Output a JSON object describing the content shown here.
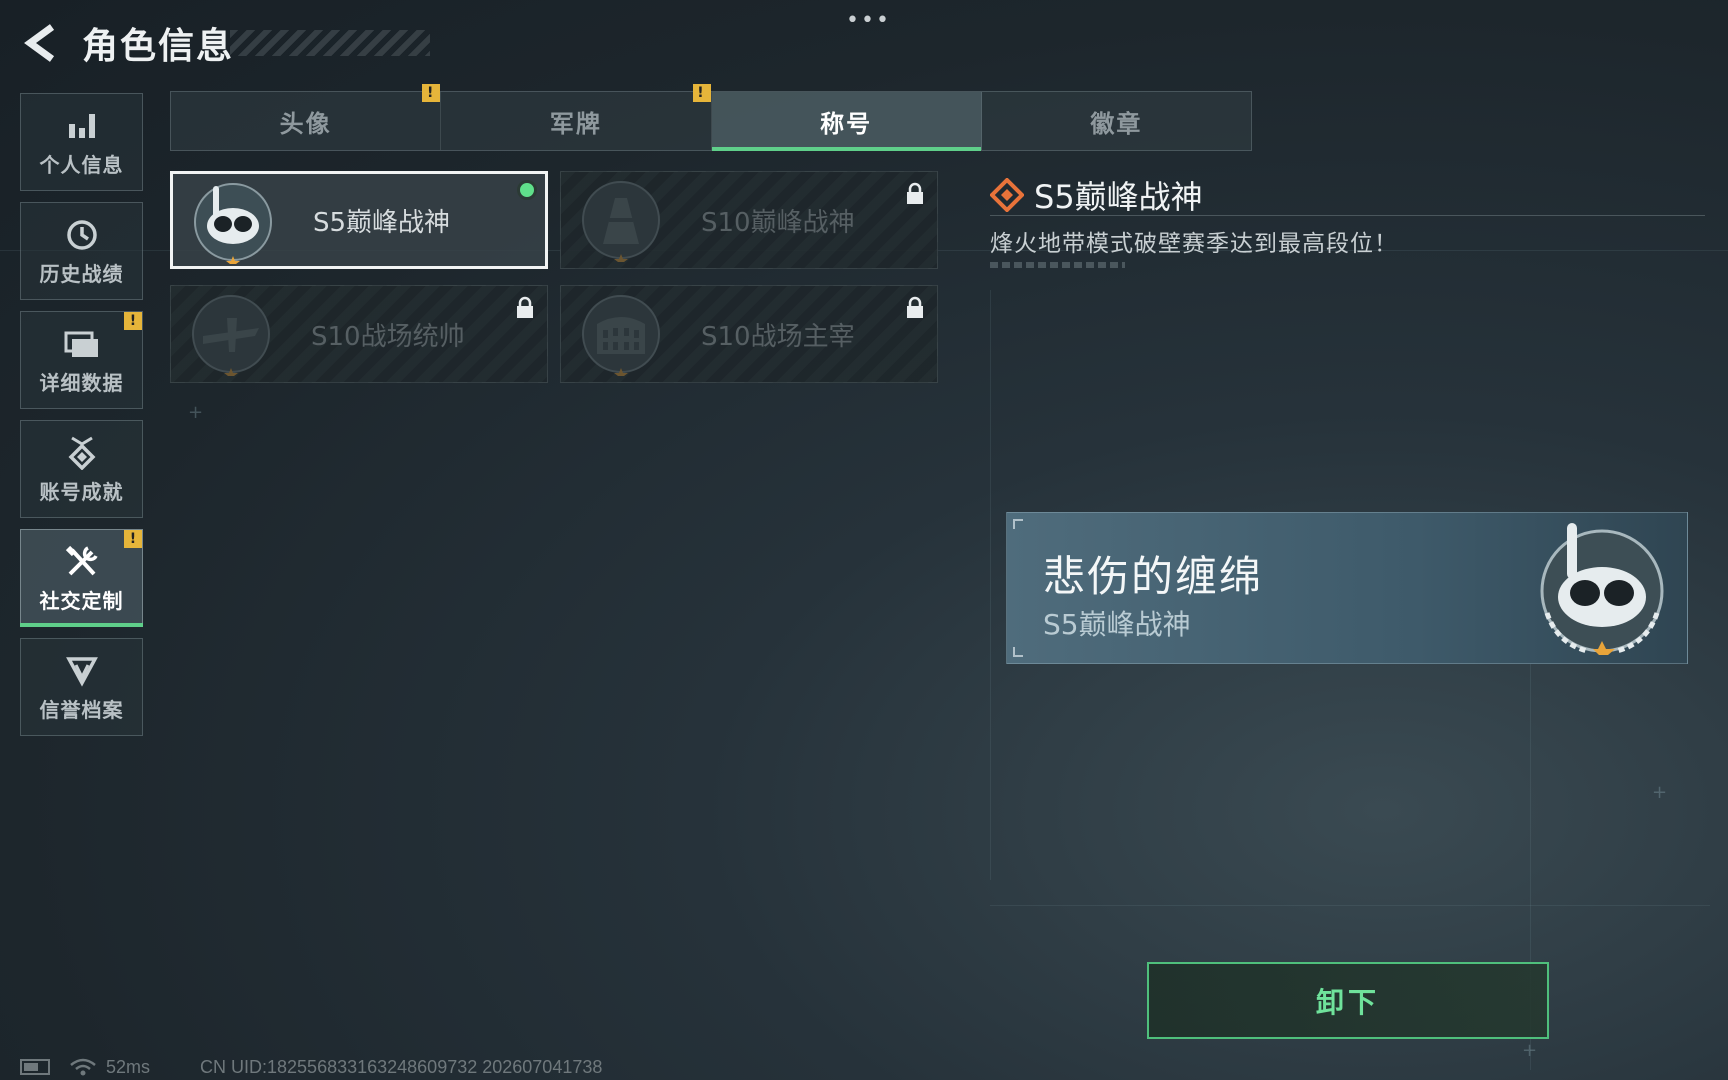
{
  "header": {
    "title": "角色信息",
    "back_icon": "back-arrow-icon",
    "more_icon": "more-dots-icon"
  },
  "sidebar": {
    "items": [
      {
        "label": "个人信息",
        "icon": "bar-chart-icon",
        "alert": false,
        "active": false
      },
      {
        "label": "历史战绩",
        "icon": "history-clock-icon",
        "alert": false,
        "active": false
      },
      {
        "label": "详细数据",
        "icon": "folder-icon",
        "alert": true,
        "active": false
      },
      {
        "label": "账号成就",
        "icon": "medal-icon",
        "alert": false,
        "active": false
      },
      {
        "label": "社交定制",
        "icon": "wrench-tools-icon",
        "alert": true,
        "active": true
      },
      {
        "label": "信誉档案",
        "icon": "shield-badge-icon",
        "alert": false,
        "active": false
      }
    ],
    "alert_symbol": "!"
  },
  "tabs": [
    {
      "label": "头像",
      "alert": true,
      "active": false
    },
    {
      "label": "军牌",
      "alert": true,
      "active": false
    },
    {
      "label": "称号",
      "alert": false,
      "active": true
    },
    {
      "label": "徽章",
      "alert": false,
      "active": false
    }
  ],
  "titles": [
    {
      "label": "S5巅峰战神",
      "emblem": "diver-mask-emblem-icon",
      "locked": false,
      "selected": true,
      "equipped": true
    },
    {
      "label": "S10巅峰战神",
      "emblem": "tower-emblem-icon",
      "locked": true,
      "selected": false,
      "equipped": false
    },
    {
      "label": "S10战场统帅",
      "emblem": "aircraft-emblem-icon",
      "locked": true,
      "selected": false,
      "equipped": false
    },
    {
      "label": "S10战场主宰",
      "emblem": "colosseum-emblem-icon",
      "locked": true,
      "selected": false,
      "equipped": false
    }
  ],
  "detail": {
    "title": "S5巅峰战神",
    "title_icon": "diamond-rank-icon",
    "description": "烽火地带模式破壁赛季达到最高段位！"
  },
  "preview": {
    "player_name": "悲伤的缠绵",
    "title": "S5巅峰战神"
  },
  "actions": {
    "unequip_label": "卸下"
  },
  "status": {
    "ping": "52ms",
    "uid": "CN UID:1825568331632486097​32 202607041738"
  },
  "colors": {
    "accent": "#5fcf8a",
    "alert": "#e6b53a",
    "rank": "#e8733a"
  }
}
